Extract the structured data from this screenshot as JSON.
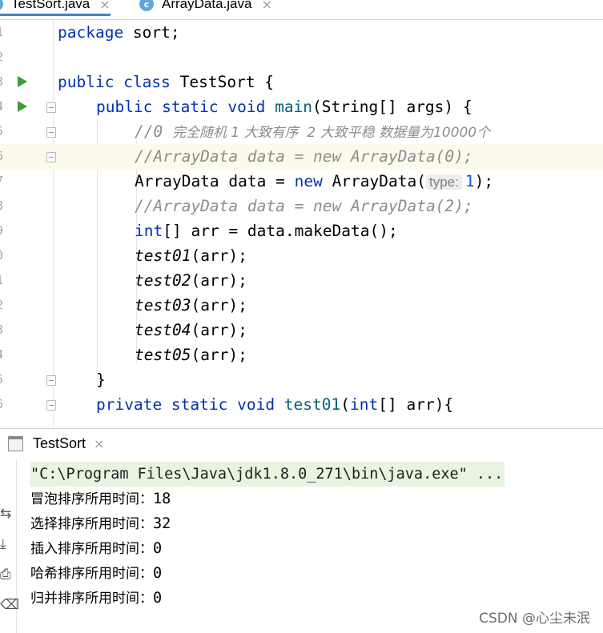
{
  "tabs": [
    {
      "label": "TestSort.java",
      "active": true
    },
    {
      "label": "ArrayData.java",
      "active": false
    }
  ],
  "tab_icon_letter": "c",
  "close_glyph": "×",
  "gutter_numbers": [
    "1",
    "2",
    "3",
    "4",
    "5",
    "6",
    "7",
    "8",
    "9",
    "0",
    "1",
    "2",
    "3",
    "4",
    "5",
    "6"
  ],
  "code": {
    "l1_kw": "package",
    "l1_rest": " sort;",
    "l3_kw1": "public",
    "l3_kw2": "class",
    "l3_rest": " TestSort {",
    "l4_kw": "public static void",
    "l4_fn": "main",
    "l4_rest": "(String[] args) {",
    "l5_comment_a": "//0 ",
    "l5_comment_cn": "完全随机 1 大致有序  2 大致平稳 数据量为10000个",
    "l6_comment": "//ArrayData data = new ArrayData(0);",
    "l7_a": "ArrayData data = ",
    "l7_kw": "new",
    "l7_b": " ArrayData(",
    "l7_hint": "type:",
    "l7_num": "1",
    "l7_c": ");",
    "l8_comment": "//ArrayData data = new ArrayData(2);",
    "l9_kw": "int",
    "l9_rest": "[] arr = data.makeData();",
    "l10": "test01",
    "l11": "test02",
    "l12": "test03",
    "l13": "test04",
    "l14": "test05",
    "call_args": "(arr);",
    "l15": "}",
    "l16_kw": "private static void",
    "l16_fn": "test01",
    "l16_open": "(",
    "l16_kw2": "int",
    "l16_rest": "[] arr){"
  },
  "run_panel": {
    "tab_label": "TestSort",
    "command": "\"C:\\Program Files\\Java\\jdk1.8.0_271\\bin\\java.exe\" ...",
    "outputs": [
      {
        "label": "冒泡排序所用时间：",
        "value": "18"
      },
      {
        "label": "选择排序所用时间：",
        "value": "32"
      },
      {
        "label": "插入排序所用时间：",
        "value": "0"
      },
      {
        "label": "哈希排序所用时间：",
        "value": "0"
      },
      {
        "label": "归并排序所用时间：",
        "value": "0"
      }
    ]
  },
  "watermark": "CSDN @心尘未泯",
  "colors": {
    "keyword": "#0033b3",
    "method": "#00627a",
    "number": "#1750eb",
    "comment": "#8c8c8c",
    "run_icon": "#3d9c3d"
  }
}
